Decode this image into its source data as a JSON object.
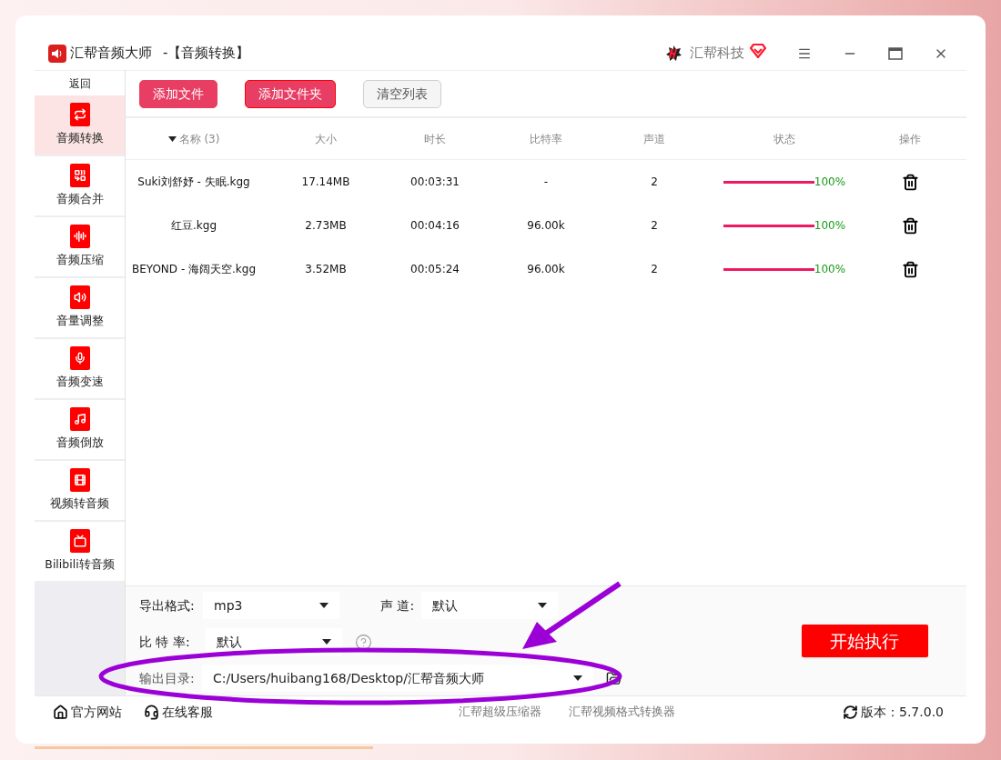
{
  "window": {
    "title": "汇帮音频大师",
    "subtitle": "-【音频转换】",
    "brand": "汇帮科技"
  },
  "sidebar": {
    "back": "返回",
    "items": [
      {
        "label": "音频转换",
        "kind": "convert",
        "selected": true
      },
      {
        "label": "音频合并",
        "kind": "merge",
        "selected": false
      },
      {
        "label": "音频压缩",
        "kind": "compress",
        "selected": false
      },
      {
        "label": "音量调整",
        "kind": "volume",
        "selected": false
      },
      {
        "label": "音频变速",
        "kind": "speed",
        "selected": false
      },
      {
        "label": "音频倒放",
        "kind": "reverse",
        "selected": false
      },
      {
        "label": "视频转音频",
        "kind": "video",
        "selected": false
      },
      {
        "label": "Bilibili转音频",
        "kind": "bilibili",
        "selected": false
      }
    ]
  },
  "toolbar": [
    {
      "label": "添加文件",
      "kind": "primary"
    },
    {
      "label": "添加文件夹",
      "kind": "outlined"
    },
    {
      "label": "清空列表",
      "kind": "plain"
    }
  ],
  "table": {
    "columns": [
      {
        "label": "名称 (3)",
        "sorted": true
      },
      {
        "label": "大小",
        "sorted": false
      },
      {
        "label": "时长",
        "sorted": false
      },
      {
        "label": "比特率",
        "sorted": false
      },
      {
        "label": "声道",
        "sorted": false
      },
      {
        "label": "状态",
        "sorted": false
      },
      {
        "label": "操作",
        "sorted": false
      }
    ],
    "rows": [
      {
        "name": "Suki刘舒妤 - 失眠.kgg",
        "size": "17.14MB",
        "duration": "00:03:31",
        "bitrate": "-",
        "channels": "2",
        "level": 1,
        "reading": "100%"
      },
      {
        "name": "红豆.kgg",
        "size": "2.73MB",
        "duration": "00:04:16",
        "bitrate": "96.00k",
        "channels": "2",
        "level": 1,
        "reading": "100%"
      },
      {
        "name": "BEYOND - 海阔天空.kgg",
        "size": "3.52MB",
        "duration": "00:05:24",
        "bitrate": "96.00k",
        "channels": "2",
        "level": 1,
        "reading": "100%"
      }
    ]
  },
  "settings": {
    "format": {
      "label": "导出格式:",
      "value": "mp3"
    },
    "channel": {
      "label": "声 道:",
      "value": "默认"
    },
    "bitrate": {
      "label": "比 特 率:",
      "value": "默认"
    },
    "output": {
      "label": "输出目录:",
      "value": "C:/Users/huibang168/Desktop/汇帮音频大师"
    },
    "start": "开始执行"
  },
  "footer": {
    "links": [
      {
        "label": "官方网站",
        "kind": "website"
      },
      {
        "label": "在线客服",
        "kind": "support"
      }
    ],
    "products": [
      "汇帮超级压缩器",
      "汇帮视频格式转换器"
    ],
    "version": "版本：5.7.0.0"
  }
}
